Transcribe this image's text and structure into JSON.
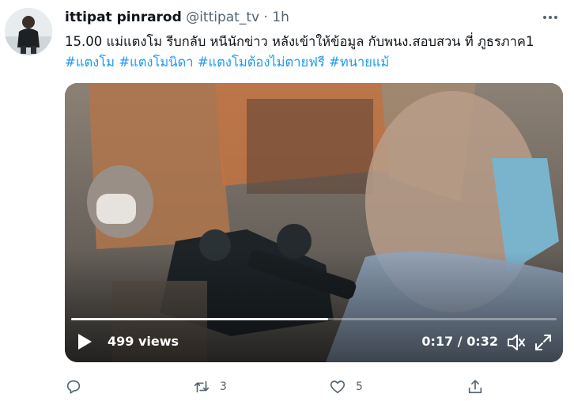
{
  "tweet": {
    "author_name": "ittipat pinrarod",
    "handle": "@ittipat_tv",
    "separator": "·",
    "time": "1h",
    "text": "15.00 แม่แตงโม รีบกลับ หนีนักข่าว หลังเข้าให้ข้อมูล กับพนง.สอบสวน ที่ ภูธรภาค1",
    "hashtags": [
      "#แตงโม",
      "#แตงโมนิดา",
      "#แตงโมต้องไม่ตายฟรี",
      "#ทนายแม้"
    ]
  },
  "video": {
    "views": "499 views",
    "time_display": "0:17 / 0:32",
    "progress": 0.53
  },
  "actions": {
    "reply_count": "",
    "retweet_count": "3",
    "like_count": "5"
  },
  "icons": {
    "more": "more-horizontal-icon",
    "play": "play-icon",
    "volume": "volume-icon",
    "fullscreen": "fullscreen-icon",
    "reply": "reply-icon",
    "retweet": "retweet-icon",
    "like": "heart-icon",
    "share": "share-icon"
  },
  "colors": {
    "link": "#1d9bf0",
    "secondary_text": "#536471"
  }
}
